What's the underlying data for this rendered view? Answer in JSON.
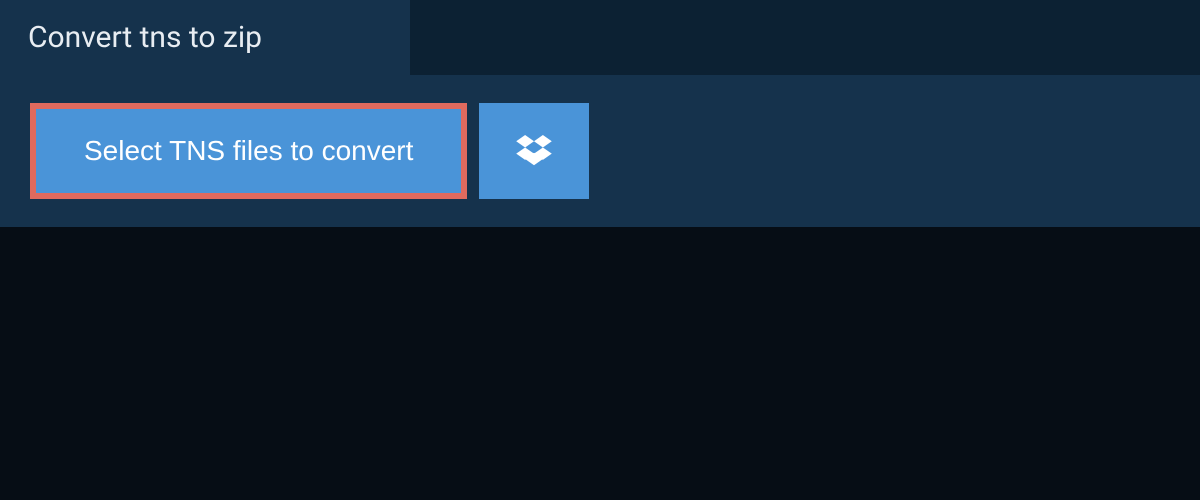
{
  "tab": {
    "title": "Convert tns to zip"
  },
  "actions": {
    "select_files_label": "Select TNS files to convert"
  },
  "colors": {
    "page_bg": "#0c2133",
    "panel_bg": "#15324c",
    "button_bg": "#4a94d8",
    "button_border": "#e06a5e",
    "text_light": "#ffffff",
    "lower_bg": "#060d15"
  }
}
